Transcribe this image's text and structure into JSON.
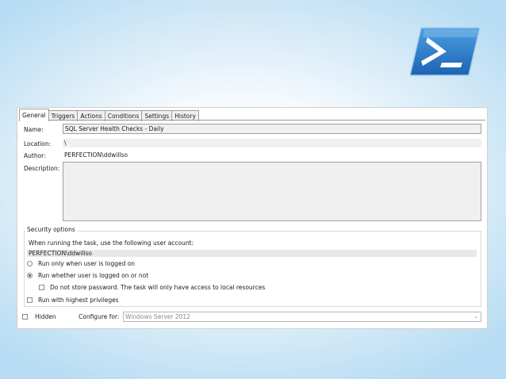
{
  "tabs": [
    {
      "label": "General",
      "active": true
    },
    {
      "label": "Triggers"
    },
    {
      "label": "Actions"
    },
    {
      "label": "Conditions"
    },
    {
      "label": "Settings"
    },
    {
      "label": "History"
    }
  ],
  "general": {
    "name_label": "Name:",
    "name_value": "SQL Server Health Checks - Daily",
    "location_label": "Location:",
    "location_value": "\\",
    "author_label": "Author:",
    "author_value": "PERFECTION\\ddwillso",
    "description_label": "Description:",
    "description_value": ""
  },
  "security": {
    "title": "Security options",
    "account_prompt": "When running the task, use the following user account:",
    "account_value": "PERFECTION\\ddwillso",
    "run_logged_on_label": "Run only when user is logged on",
    "run_whether_label": "Run whether user is logged on or not",
    "selected_option": "run_whether",
    "no_store_password_label": "Do not store password.  The task will only have access to local resources",
    "highest_privileges_label": "Run with highest privileges"
  },
  "footer": {
    "hidden_label": "Hidden",
    "configure_label": "Configure for:",
    "configure_value": "Windows Server 2012"
  },
  "icons": {
    "logo": "powershell-logo-icon",
    "dropdown": "chevron-down-icon"
  }
}
